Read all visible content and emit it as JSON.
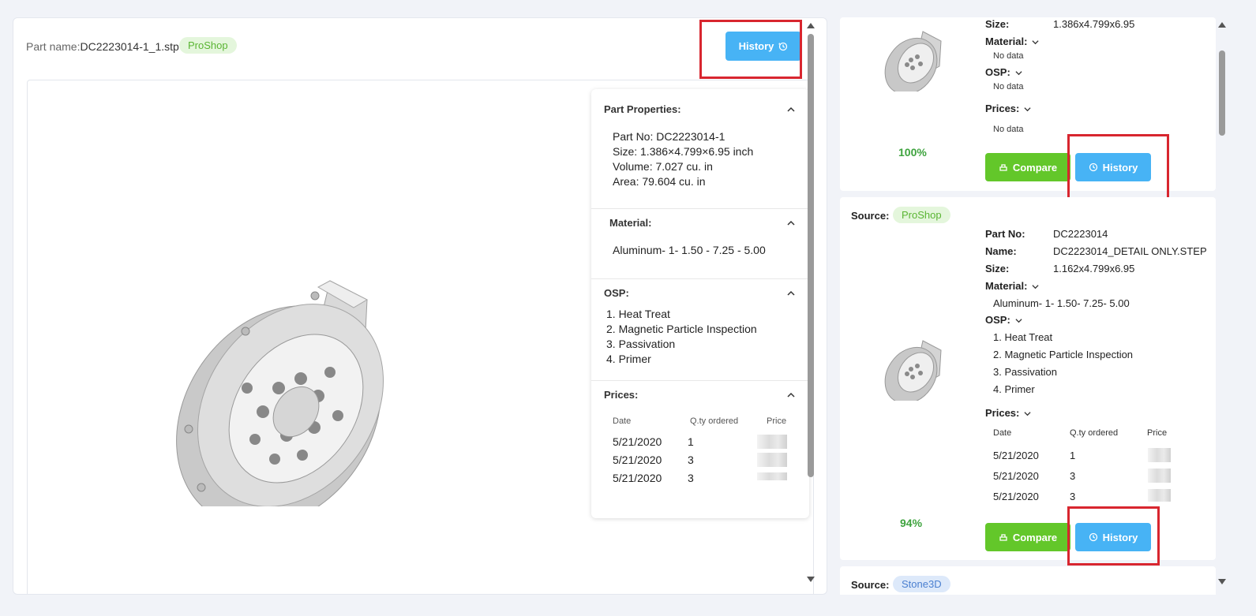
{
  "main": {
    "part_name_label": "Part name:",
    "part_name_value": "DC2223014-1_1.stp",
    "source_tag": "ProShop",
    "history_label": "History",
    "properties": {
      "title": "Part Properties:",
      "lines": [
        "Part No: DC2223014-1",
        "Size: 1.386×4.799×6.95 inch",
        "Volume: 7.027 cu. in",
        "Area: 79.604 cu. in"
      ]
    },
    "material": {
      "title": "Material:",
      "value": "Aluminum- 1- 1.50 - 7.25 - 5.00"
    },
    "osp": {
      "title": "OSP:",
      "items": [
        "1. Heat Treat",
        "2. Magnetic Particle Inspection",
        "3. Passivation",
        "4. Primer"
      ]
    },
    "prices": {
      "title": "Prices:",
      "headers": [
        "Date",
        "Q.ty ordered",
        "Price"
      ],
      "rows": [
        {
          "date": "5/21/2020",
          "qty": "1"
        },
        {
          "date": "5/21/2020",
          "qty": "3"
        },
        {
          "date": "5/21/2020",
          "qty": "3"
        }
      ]
    }
  },
  "results": [
    {
      "size_label": "Size:",
      "size": "1.386x4.799x6.95",
      "material_label": "Material:",
      "material": "No data",
      "osp_label": "OSP:",
      "osp": "No data",
      "prices_label": "Prices:",
      "prices": "No data",
      "match": "100%",
      "compare_label": "Compare",
      "history_label": "History"
    },
    {
      "source_label": "Source:",
      "source": "ProShop",
      "partno_label": "Part No:",
      "partno": "DC2223014",
      "name_label": "Name:",
      "name": "DC2223014_DETAIL ONLY.STEP",
      "size_label": "Size:",
      "size": "1.162x4.799x6.95",
      "material_label": "Material:",
      "material": "Aluminum- 1- 1.50- 7.25- 5.00",
      "osp_label": "OSP:",
      "osp": [
        "1. Heat Treat",
        "2. Magnetic Particle Inspection",
        "3. Passivation",
        "4. Primer"
      ],
      "prices_label": "Prices:",
      "price_headers": [
        "Date",
        "Q.ty ordered",
        "Price"
      ],
      "price_rows": [
        {
          "date": "5/21/2020",
          "qty": "1"
        },
        {
          "date": "5/21/2020",
          "qty": "3"
        },
        {
          "date": "5/21/2020",
          "qty": "3"
        }
      ],
      "match": "94%",
      "compare_label": "Compare",
      "history_label": "History"
    },
    {
      "source_label": "Source:",
      "source": "Stone3D"
    }
  ]
}
